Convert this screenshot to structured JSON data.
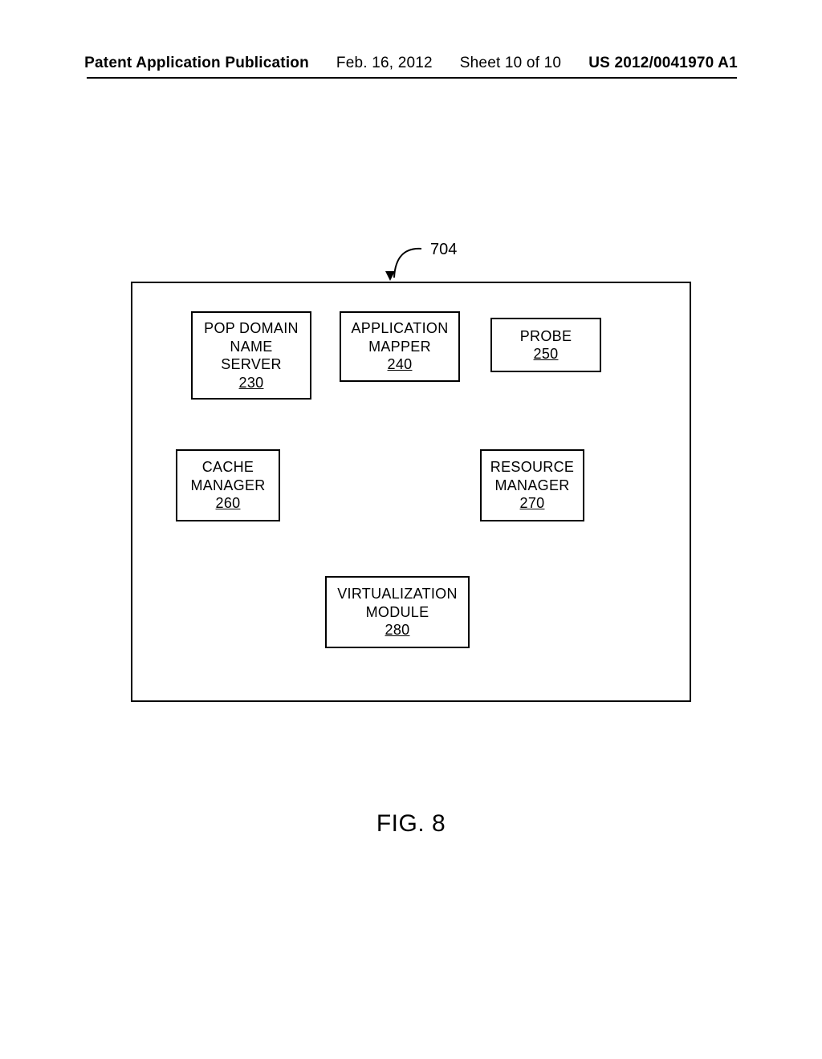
{
  "header": {
    "pub": "Patent Application Publication",
    "date": "Feb. 16, 2012",
    "sheet": "Sheet 10 of 10",
    "docnum": "US 2012/0041970 A1"
  },
  "ref": "704",
  "modules": {
    "m230": {
      "l1": "POP DOMAIN",
      "l2": "NAME",
      "l3": "SERVER",
      "num": "230"
    },
    "m240": {
      "l1": "APPLICATION",
      "l2": "MAPPER",
      "num": "240"
    },
    "m250": {
      "l1": "PROBE",
      "num": "250"
    },
    "m260": {
      "l1": "CACHE",
      "l2": "MANAGER",
      "num": "260"
    },
    "m270": {
      "l1": "RESOURCE",
      "l2": "MANAGER",
      "num": "270"
    },
    "m280": {
      "l1": "VIRTUALIZATION",
      "l2": "MODULE",
      "num": "280"
    }
  },
  "caption": "FIG. 8"
}
